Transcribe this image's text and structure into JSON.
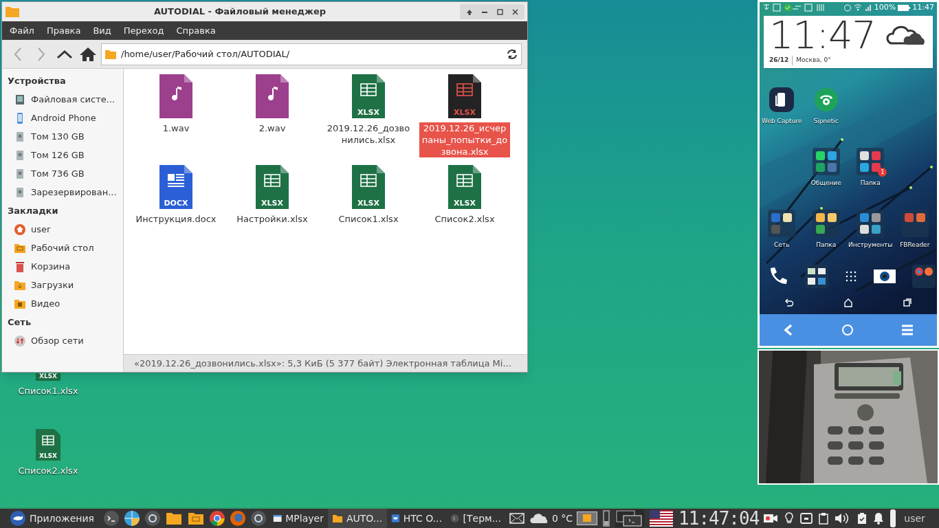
{
  "desktop_icons": [
    {
      "label": "Список1.xlsx",
      "badge": "XLSX"
    },
    {
      "label": "Список2.xlsx",
      "badge": "XLSX"
    }
  ],
  "window": {
    "title": "AUTODIAL - Файловый менеджер",
    "menu": [
      "Файл",
      "Правка",
      "Вид",
      "Переход",
      "Справка"
    ],
    "path": "/home/user/Рабочий стол/AUTODIAL/",
    "sidebar": [
      {
        "heading": "Устройства",
        "items": [
          {
            "label": "Файловая систе...",
            "kind": "disk"
          },
          {
            "label": "Android Phone",
            "kind": "phone"
          },
          {
            "label": "Том 130 GB",
            "kind": "drive"
          },
          {
            "label": "Том 126 GB",
            "kind": "drive"
          },
          {
            "label": "Том 736 GB",
            "kind": "drive"
          },
          {
            "label": "Зарезервирован...",
            "kind": "drive"
          }
        ]
      },
      {
        "heading": "Закладки",
        "items": [
          {
            "label": "user",
            "kind": "home"
          },
          {
            "label": "Рабочий стол",
            "kind": "desktop"
          },
          {
            "label": "Корзина",
            "kind": "trash"
          },
          {
            "label": "Загрузки",
            "kind": "download"
          },
          {
            "label": "Видео",
            "kind": "video"
          }
        ]
      },
      {
        "heading": "Сеть",
        "items": [
          {
            "label": "Обзор сети",
            "kind": "network"
          }
        ]
      }
    ],
    "files": [
      {
        "name": "1.wav",
        "kind": "audio",
        "selected": false
      },
      {
        "name": "2.wav",
        "kind": "audio",
        "selected": false
      },
      {
        "name": "2019.12.26_дозвонились.xlsx",
        "kind": "sheet",
        "badge": "XLSX",
        "selected": false
      },
      {
        "name": "2019.12.26_исчерпаны_попытки_дозвона.xlsx",
        "kind": "sheet",
        "badge": "XLSX",
        "selected": true
      },
      {
        "name": "Инструкция.docx",
        "kind": "doc",
        "badge": "DOCX",
        "selected": false
      },
      {
        "name": "Настройки.xlsx",
        "kind": "sheet",
        "badge": "XLSX",
        "selected": false
      },
      {
        "name": "Список1.xlsx",
        "kind": "sheet",
        "badge": "XLSX",
        "selected": false
      },
      {
        "name": "Список2.xlsx",
        "kind": "sheet",
        "badge": "XLSX",
        "selected": false
      }
    ],
    "status_bar": "«2019.12.26_дозвонились.xlsx»: 5,3 КиБ (5 377 байт) Электронная таблица Mi..."
  },
  "phone": {
    "battery": "100%",
    "status_time": "11:47",
    "clock": "11:47",
    "date": "26/12",
    "place": "Москва, 0°",
    "apps": [
      {
        "label": "Web Capture",
        "kind": "capture"
      },
      {
        "label": "Sipnetic",
        "kind": "sip"
      },
      {
        "label": "Общение",
        "kind": "folder"
      },
      {
        "label": "Папка",
        "kind": "folder",
        "badge": "1"
      },
      {
        "label": "Сеть",
        "kind": "folder"
      },
      {
        "label": "Папка",
        "kind": "folder"
      },
      {
        "label": "Инструменты",
        "kind": "folder"
      },
      {
        "label": "FBReader",
        "kind": "folder"
      }
    ]
  },
  "taskbar": {
    "start": "Приложения",
    "tasks": [
      {
        "label": "MPlayer",
        "selected": false
      },
      {
        "label": "AUTO...",
        "selected": true
      },
      {
        "label": "HTC O...",
        "selected": false
      },
      {
        "label": "[Терм...",
        "selected": false
      }
    ],
    "weather": "0 °C",
    "clock": "11:47:04",
    "user": "user"
  }
}
